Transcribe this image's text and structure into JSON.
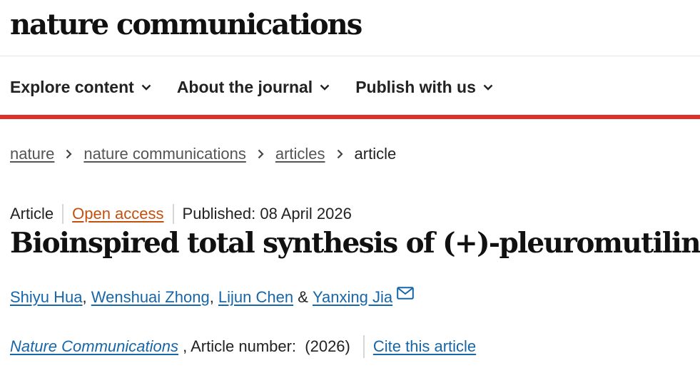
{
  "site": {
    "brand": "nature communications"
  },
  "nav": {
    "items": [
      {
        "label": "Explore content",
        "icon": "chevron-down-icon"
      },
      {
        "label": "About the journal",
        "icon": "chevron-down-icon"
      },
      {
        "label": "Publish with us",
        "icon": "chevron-down-icon"
      }
    ]
  },
  "breadcrumb": {
    "links": [
      "nature",
      "nature communications",
      "articles"
    ],
    "current": "article",
    "separator_icon": "chevron-right-icon"
  },
  "article": {
    "type": "Article",
    "access": "Open access",
    "published": "Published: 08 April 2026",
    "title": "Bioinspired total synthesis of (+)-pleuromutilin",
    "authors": [
      "Shiyu Hua",
      "Wenshuai Zhong",
      "Lijun Chen",
      "Yanxing Jia"
    ],
    "author_separators": [
      ", ",
      ", ",
      " & "
    ],
    "contact_icon": "mail-icon",
    "journal": "Nature Communications",
    "article_number_label": " , Article number:  (2026)",
    "cite_label": "Cite this article"
  },
  "colors": {
    "accent_bar": "#e0302a",
    "link": "#1766a8",
    "open_access": "#c4500f"
  }
}
